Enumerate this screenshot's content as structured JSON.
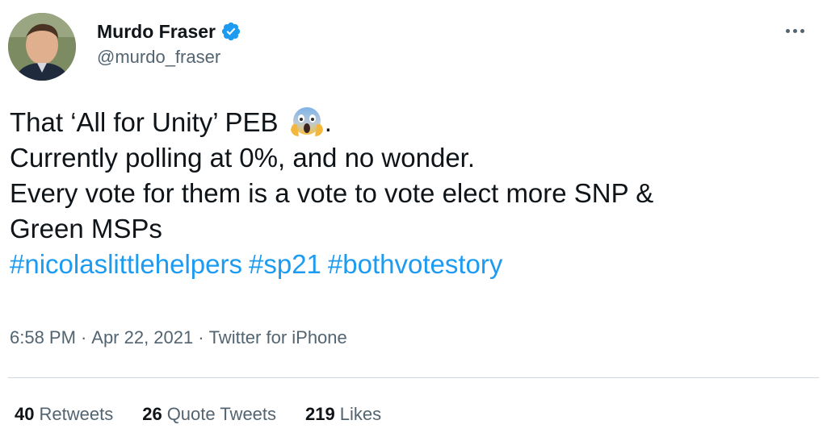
{
  "author": {
    "display_name": "Murdo Fraser",
    "handle": "@murdo_fraser",
    "verified": true
  },
  "tweet": {
    "line1_text": "That ‘All for Unity’ PEB",
    "line1_emoji": "face-screaming-in-fear-emoji",
    "line1_end": ".",
    "line2": "Currently polling at 0%, and no wonder.",
    "line3": "Every vote for them is a vote to vote elect more SNP &",
    "line4": "Green MSPs",
    "hashtags": [
      "#nicolaslittlehelpers",
      "#sp21",
      "#bothvotestory"
    ]
  },
  "meta": {
    "time": "6:58 PM",
    "sep1": "·",
    "date": "Apr 22, 2021",
    "sep2": "·",
    "source": "Twitter for iPhone"
  },
  "stats": {
    "retweets": {
      "count": "40",
      "label": "Retweets"
    },
    "quotes": {
      "count": "26",
      "label": "Quote Tweets"
    },
    "likes": {
      "count": "219",
      "label": "Likes"
    }
  },
  "colors": {
    "link": "#1d9bf0",
    "text": "#0f1419",
    "muted": "#536471",
    "verified": "#1d9bf0"
  }
}
